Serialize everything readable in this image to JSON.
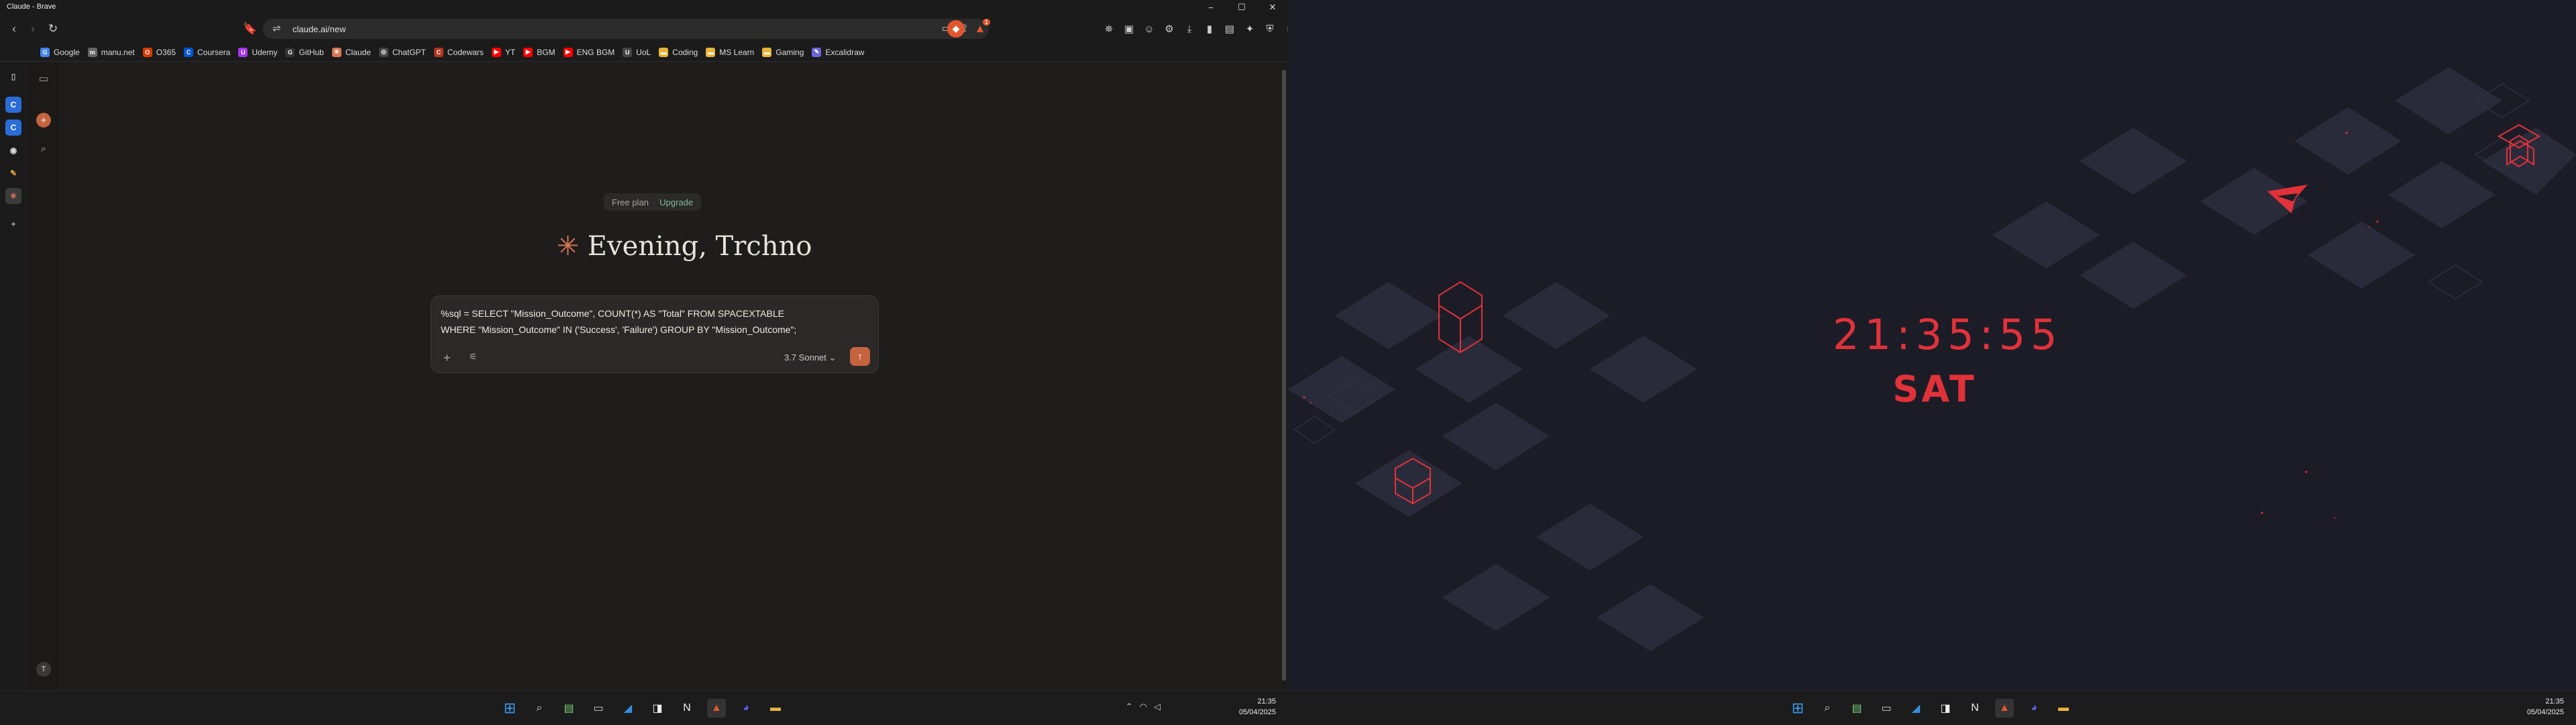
{
  "window": {
    "title": "Claude - Brave",
    "minimize": "−",
    "maximize": "☐",
    "close": "✕"
  },
  "browser": {
    "url": "claude.ai/new",
    "shield_count": "1",
    "bookmarks": [
      {
        "label": "Google",
        "color": "#4285f4",
        "glyph": "G"
      },
      {
        "label": "manu.net",
        "color": "#666",
        "glyph": "m"
      },
      {
        "label": "O365",
        "color": "#d83b01",
        "glyph": "O"
      },
      {
        "label": "Coursera",
        "color": "#0056d2",
        "glyph": "C"
      },
      {
        "label": "Udemy",
        "color": "#a435f0",
        "glyph": "U"
      },
      {
        "label": "GitHub",
        "color": "#333",
        "glyph": "G"
      },
      {
        "label": "Claude",
        "color": "#d97757",
        "glyph": "✳"
      },
      {
        "label": "ChatGPT",
        "color": "#444",
        "glyph": "◎"
      },
      {
        "label": "Codewars",
        "color": "#b1361e",
        "glyph": "C"
      },
      {
        "label": "YT",
        "color": "#ff0000",
        "glyph": "▶"
      },
      {
        "label": "BGM",
        "color": "#ff0000",
        "glyph": "▶"
      },
      {
        "label": "ENG BGM",
        "color": "#ff0000",
        "glyph": "▶"
      },
      {
        "label": "UoL",
        "color": "#444",
        "glyph": "U"
      },
      {
        "label": "Coding",
        "color": "#e8b53a",
        "glyph": "▬"
      },
      {
        "label": "MS Learn",
        "color": "#e8b53a",
        "glyph": "▬"
      },
      {
        "label": "Gaming",
        "color": "#e8b53a",
        "glyph": "▬"
      },
      {
        "label": "Excalidraw",
        "color": "#6965db",
        "glyph": "✎"
      }
    ]
  },
  "claude": {
    "plan_text": "Free plan",
    "plan_sep": "·",
    "upgrade_label": "Upgrade",
    "greeting_icon": "✳",
    "greeting": "Evening, Trchno",
    "prompt_line1": "%sql = SELECT \"Mission_Outcome\", COUNT(*) AS \"Total\" FROM SPACEXTABLE",
    "prompt_line2": "WHERE \"Mission_Outcome\" IN ('Success', 'Failure') GROUP BY \"Mission_Outcome\";",
    "model": "3.7 Sonnet ⌄",
    "send_icon": "↑"
  },
  "taskbar_left": {
    "time": "21:35",
    "date": "05/04/2025"
  },
  "wallpaper": {
    "time": "21:35:55",
    "day": "SAT"
  },
  "taskbar_right": {
    "time": "21:35",
    "date": "05/04/2025"
  }
}
